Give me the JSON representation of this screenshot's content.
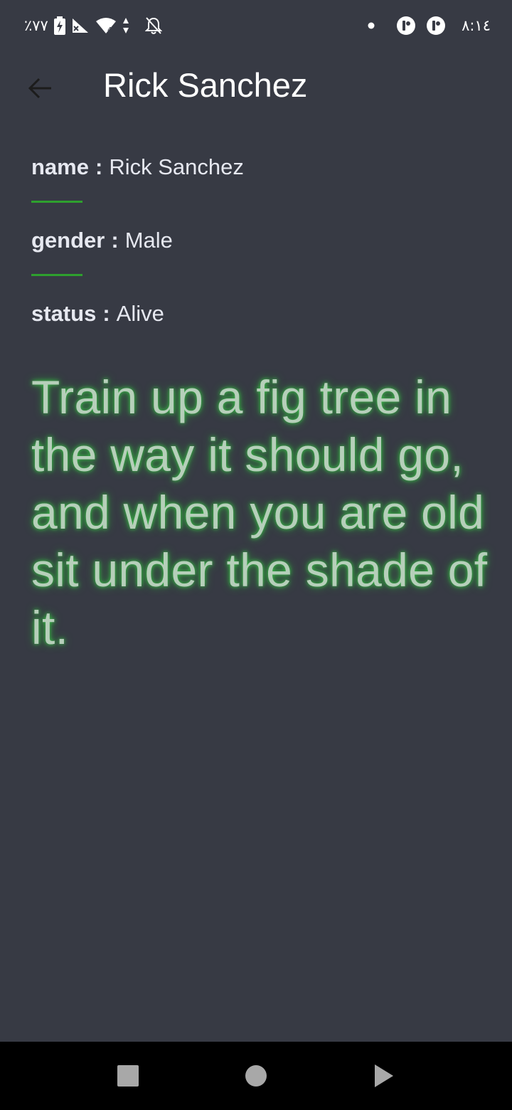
{
  "status_bar": {
    "battery_percent": "٪٧٧",
    "time": "٨:١٤",
    "icons": [
      "battery-charging-icon",
      "no-signal-icon",
      "wifi-icon",
      "data-arrows-icon",
      "notifications-off-icon",
      "dot-icon",
      "app-notification-icon",
      "app-notification-icon"
    ]
  },
  "app_bar": {
    "title": "Rick Sanchez",
    "back_icon": "arrow-left-icon"
  },
  "details": {
    "name_key": "name",
    "name_value": "Rick Sanchez",
    "gender_key": "gender",
    "gender_value": "Male",
    "status_key": "status",
    "status_value": "Alive",
    "separator": ":"
  },
  "quote": "Train up a fig tree in the way it should go, and when you are old sit under the shade of it.",
  "nav_bar": {
    "icons": [
      "recents-square-icon",
      "home-circle-icon",
      "back-triangle-icon"
    ]
  },
  "colors": {
    "background": "#373a44",
    "divider": "#2ea02e",
    "quote_text": "#b6cfba",
    "quote_glow": "#3cc24a",
    "nav_bar": "#000000"
  }
}
